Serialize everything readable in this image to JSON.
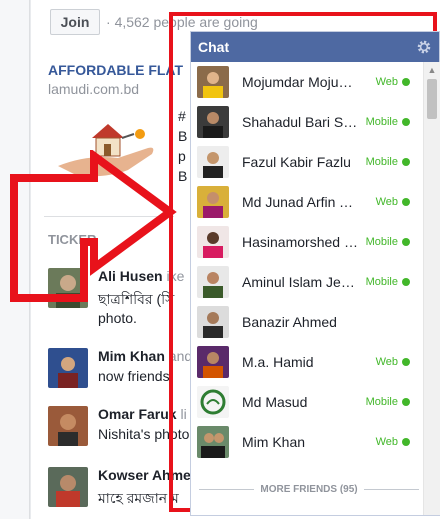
{
  "event": {
    "join_label": "Join",
    "going_text": "4,562 people are going"
  },
  "ad": {
    "title": "AFFORDABLE FLAT",
    "domain": "lamudi.com.bd",
    "snippet": "#\nB\np\nB"
  },
  "ticker": {
    "label": "TICKER",
    "stories": [
      {
        "name": "Ali Husen",
        "tail": " ike",
        "line": "ছাত্রশিবির (সি",
        "extra": "photo."
      },
      {
        "name": "Mim Khan",
        "tail": " and",
        "line": "now friends."
      },
      {
        "name": "Omar Faruk",
        "tail": " li",
        "line": "Nishita's photo"
      },
      {
        "name": "Kowser Ahme",
        "tail": "",
        "line": "মাহে রমজান ম"
      }
    ]
  },
  "chat": {
    "title": "Chat",
    "more_friends": "MORE FRIENDS (95)",
    "colors": {
      "header": "#4e69a2",
      "online": "#42b72a",
      "frame": "#e8121b"
    },
    "friends": [
      {
        "name": "Mojumdar Mojumdar",
        "status": "Web"
      },
      {
        "name": "Shahadul Bari Shahin",
        "status": "Mobile"
      },
      {
        "name": "Fazul Kabir Fazlu",
        "status": "Mobile"
      },
      {
        "name": "Md Junad Arfin Tanvir",
        "status": "Web"
      },
      {
        "name": "Hasinamorshed Hasina",
        "status": "Mobile"
      },
      {
        "name": "Aminul Islam Jewel",
        "status": "Mobile"
      },
      {
        "name": "Banazir Ahmed",
        "status": ""
      },
      {
        "name": "M.a. Hamid",
        "status": "Web"
      },
      {
        "name": "Md Masud",
        "status": "Mobile"
      },
      {
        "name": "Mim Khan",
        "status": "Web"
      }
    ]
  }
}
